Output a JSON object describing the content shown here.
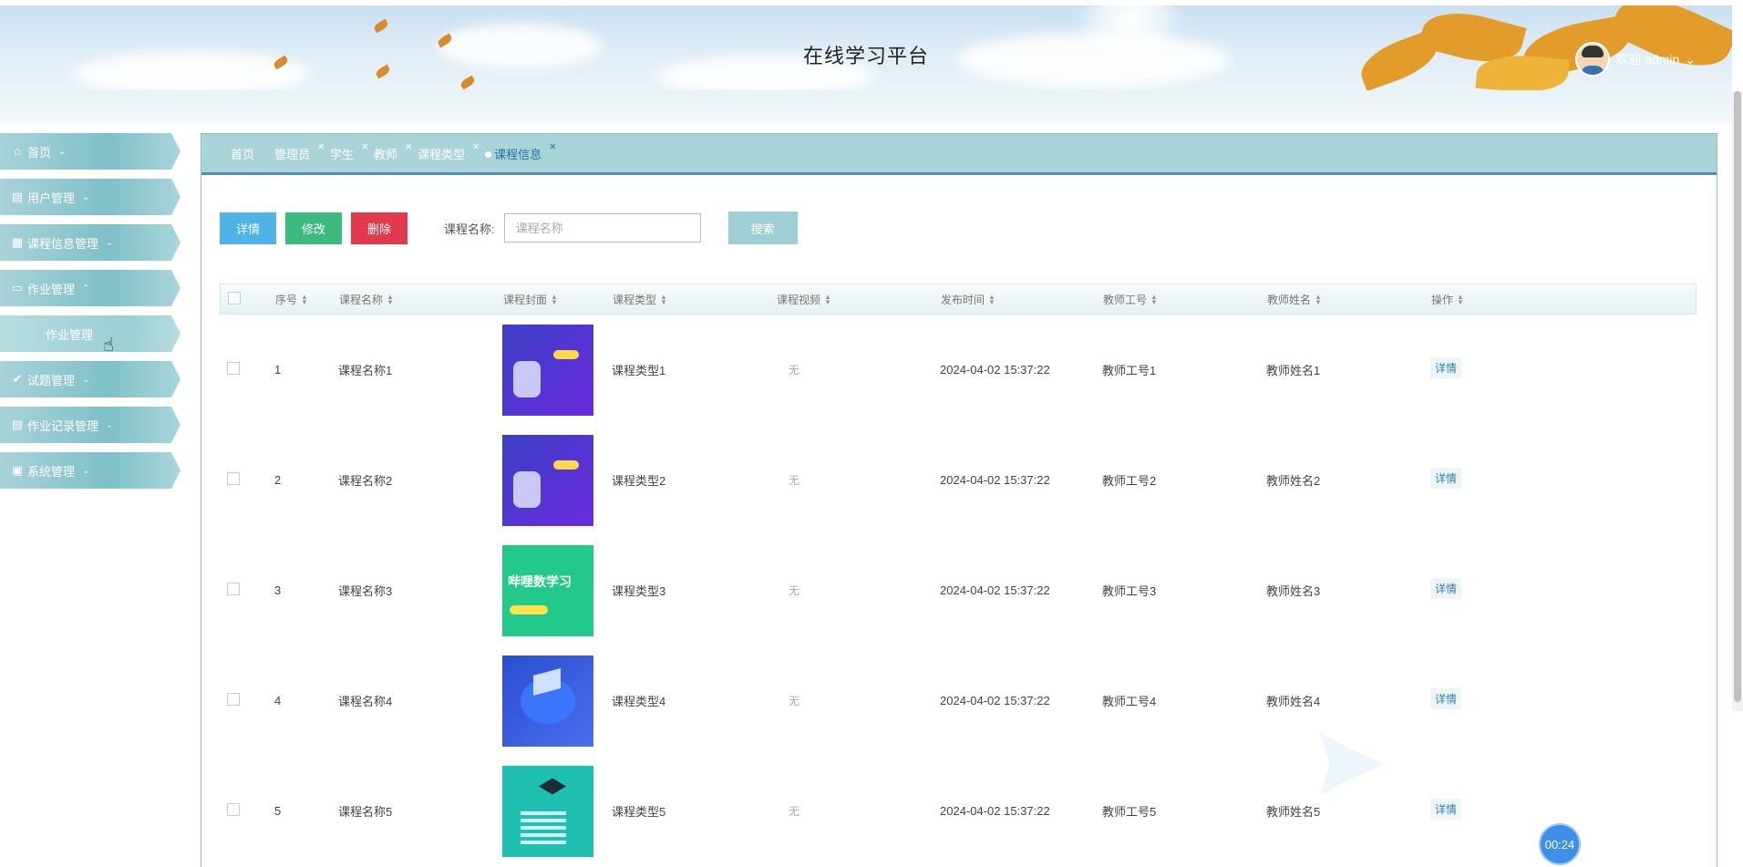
{
  "header": {
    "title": "在线学习平台",
    "welcome": "欢迎 admin",
    "dropdown": "⌄"
  },
  "sidebar": {
    "items": [
      {
        "label": "首页",
        "icon": "home-icon",
        "glyph": "⌂",
        "chevron": "⌄"
      },
      {
        "label": "用户管理",
        "icon": "users-icon",
        "glyph": "▤",
        "chevron": "⌄"
      },
      {
        "label": "课程信息管理",
        "icon": "grid-icon",
        "glyph": "▦",
        "chevron": "⌄"
      },
      {
        "label": "作业管理",
        "icon": "folder-icon",
        "glyph": "▭",
        "chevron": "⌃"
      },
      {
        "label": "作业管理",
        "icon": "",
        "glyph": "",
        "chevron": "",
        "sub": true
      },
      {
        "label": "试题管理",
        "icon": "check-circle-icon",
        "glyph": "✔",
        "chevron": "⌄"
      },
      {
        "label": "作业记录管理",
        "icon": "book-icon",
        "glyph": "▤",
        "chevron": "⌄"
      },
      {
        "label": "系统管理",
        "icon": "settings-icon",
        "glyph": "▣",
        "chevron": "⌄"
      }
    ]
  },
  "tabs": [
    {
      "label": "首页",
      "closable": false
    },
    {
      "label": "管理员",
      "closable": true
    },
    {
      "label": "学生",
      "closable": true
    },
    {
      "label": "教师",
      "closable": true
    },
    {
      "label": "课程类型",
      "closable": true
    },
    {
      "label": "课程信息",
      "closable": true,
      "active": true
    }
  ],
  "toolbar": {
    "detail": "详情",
    "edit": "修改",
    "delete": "删除",
    "search_label": "课程名称:",
    "search_placeholder": "课程名称",
    "search_button": "搜索"
  },
  "table": {
    "columns": [
      "序号",
      "课程名称",
      "课程封面",
      "课程类型",
      "课程视频",
      "发布时间",
      "教师工号",
      "教师姓名",
      "操作"
    ],
    "rows": [
      {
        "no": "1",
        "name": "课程名称1",
        "cover": "cover-a",
        "type": "课程类型1",
        "video": "无",
        "time": "2024-04-02 15:37:22",
        "tid": "教师工号1",
        "tname": "教师姓名1",
        "op": "详情"
      },
      {
        "no": "2",
        "name": "课程名称2",
        "cover": "cover-a",
        "type": "课程类型2",
        "video": "无",
        "time": "2024-04-02 15:37:22",
        "tid": "教师工号2",
        "tname": "教师姓名2",
        "op": "详情"
      },
      {
        "no": "3",
        "name": "课程名称3",
        "cover": "cover-b",
        "type": "课程类型3",
        "video": "无",
        "time": "2024-04-02 15:37:22",
        "tid": "教师工号3",
        "tname": "教师姓名3",
        "op": "详情"
      },
      {
        "no": "4",
        "name": "课程名称4",
        "cover": "cover-c",
        "type": "课程类型4",
        "video": "无",
        "time": "2024-04-02 15:37:22",
        "tid": "教师工号4",
        "tname": "教师姓名4",
        "op": "详情"
      },
      {
        "no": "5",
        "name": "课程名称5",
        "cover": "cover-d",
        "type": "课程类型5",
        "video": "无",
        "time": "2024-04-02 15:37:22",
        "tid": "教师工号5",
        "tname": "教师姓名5",
        "op": "详情"
      }
    ]
  },
  "timer": "00:24",
  "colors": {
    "accent": "#4f8fb0",
    "sidebar": "#7fc0c8",
    "detail": "#4fb3e6",
    "edit": "#3dbb7f",
    "delete": "#e2394c"
  }
}
